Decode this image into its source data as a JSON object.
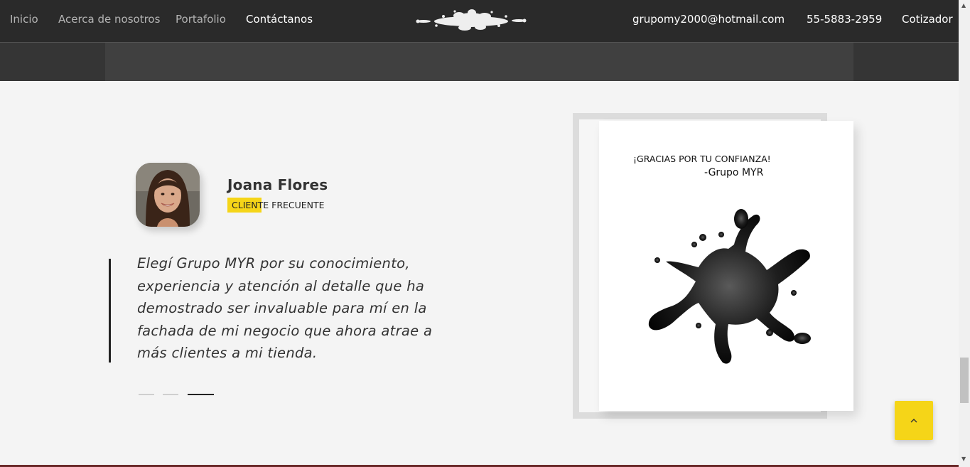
{
  "nav": {
    "links": [
      "Inicio",
      "Acerca de nosotros",
      "Portafolio",
      "Contáctanos"
    ],
    "email": "grupomy2000@hotmail.com",
    "phone": "55-5883-2959",
    "quote_link": "Cotizador"
  },
  "testimonial": {
    "name": "Joana Flores",
    "role": "CLIENTE FRECUENTE",
    "quote": "Elegí Grupo MYR por su conocimiento, experiencia y atención al detalle que ha demostrado ser invaluable para mí en la fachada de mi negocio que ahora atrae a más clientes a mi tienda.",
    "slides_total": 3,
    "active_slide": 3
  },
  "card": {
    "title": "¡GRACIAS POR TU CONFIANZA!",
    "signature": "-Grupo MYR"
  },
  "icons": {
    "logo": "ink-splash-logo",
    "back_to_top": "chevron-up-icon",
    "card_image": "ink-splash-image"
  },
  "colors": {
    "nav_bg": "#2a2a2a",
    "accent": "#f5d518",
    "page_bg": "#f4f4f4"
  }
}
